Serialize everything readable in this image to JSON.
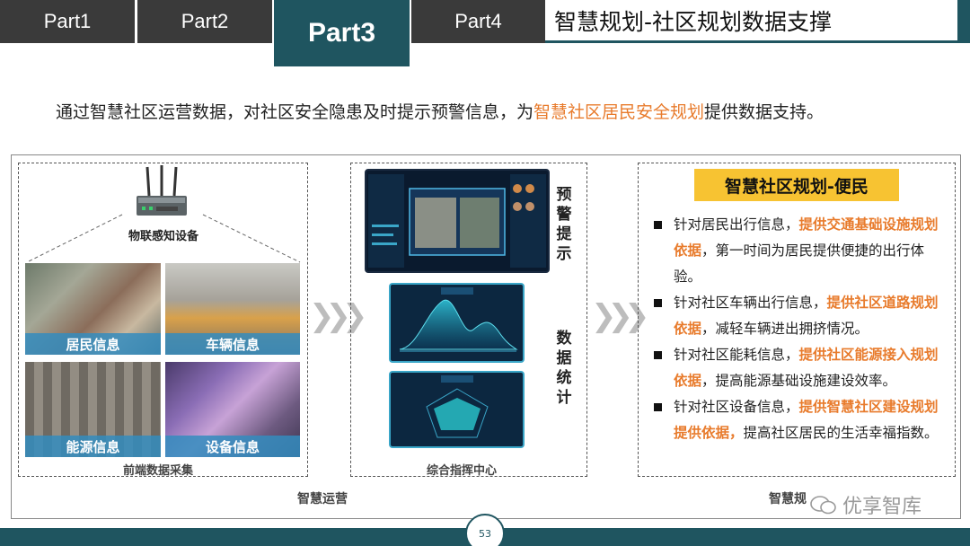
{
  "tabs": [
    {
      "label": "Part1"
    },
    {
      "label": "Part2"
    },
    {
      "label": "Part3"
    },
    {
      "label": "Part4"
    }
  ],
  "title": "智慧规划-社区规划数据支撑",
  "intro": {
    "before": "通过智慧社区运营数据，对社区安全隐患及时提示预警信息，为",
    "highlight": "智慧社区居民安全规划",
    "after": "提供数据支持。"
  },
  "colors": {
    "accent": "#1f5560",
    "highlight": "#e87b2c",
    "badge": "#f7c332"
  },
  "collection": {
    "device_label": "物联感知设备",
    "tiles": [
      {
        "label": "居民信息"
      },
      {
        "label": "车辆信息"
      },
      {
        "label": "能源信息"
      },
      {
        "label": "设备信息"
      }
    ],
    "footer": "前端数据采集"
  },
  "command": {
    "warning_label": "预警提示",
    "stats_label": "数据统计",
    "footer": "综合指挥中心"
  },
  "planning": {
    "badge": "智慧社区规划-便民",
    "bullets": [
      {
        "before": "针对居民出行信息，",
        "highlight": "提供交通基础设施规划依据",
        "after": "，第一时间为居民提供便捷的出行体验。"
      },
      {
        "before": "针对社区车辆出行信息，",
        "highlight": "提供社区道路规划依据",
        "after": "，减轻车辆进出拥挤情况。"
      },
      {
        "before": "针对社区能耗信息，",
        "highlight": "提供社区能源接入规划依据",
        "after": "，提高能源基础设施建设效率。"
      },
      {
        "before": "针对社区设备信息，",
        "highlight": "提供智慧社区建设规划提供依据，",
        "after": "提高社区居民的生活幸福指数。"
      }
    ]
  },
  "bottom_labels": {
    "left": "智慧运营",
    "right": "智慧规"
  },
  "page_number": "53",
  "watermark": "优享智库"
}
